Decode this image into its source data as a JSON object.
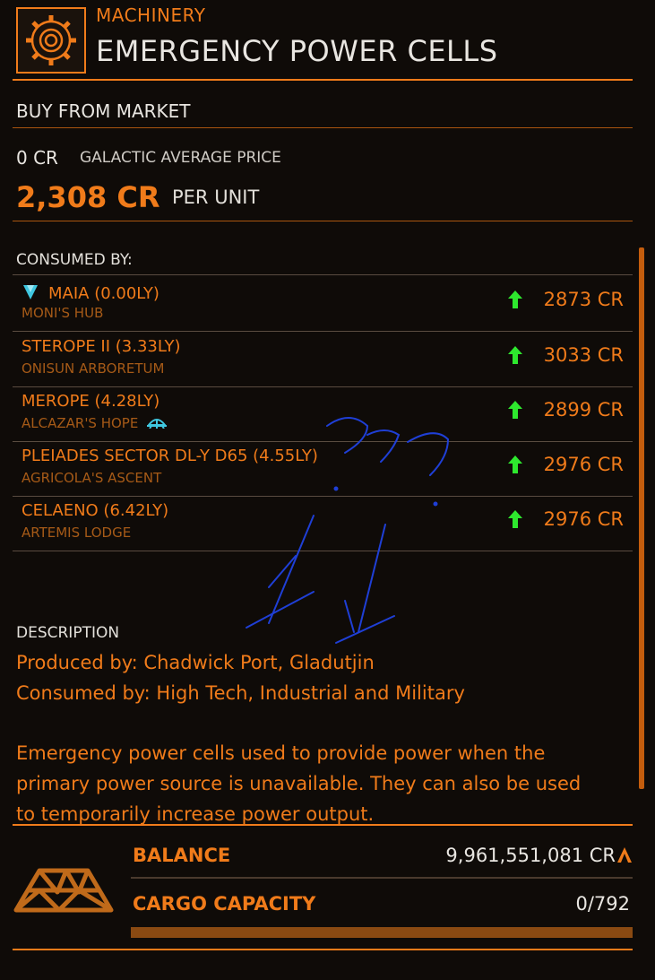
{
  "header": {
    "category": "MACHINERY",
    "title": "EMERGENCY POWER CELLS",
    "icon": "gear-icon"
  },
  "market": {
    "buy_label": "BUY FROM MARKET",
    "avg_price": "0 CR",
    "avg_label": "GALACTIC AVERAGE PRICE",
    "unit_price": "2,308 CR",
    "unit_label": "PER UNIT"
  },
  "consumed": {
    "label": "CONSUMED BY:",
    "rows": [
      {
        "name": "MAIA (0.00LY)",
        "station": "MONI'S HUB",
        "price": "2873 CR",
        "icon": "gem-icon"
      },
      {
        "name": "STEROPE II (3.33LY)",
        "station": "ONISUN ARBORETUM",
        "price": "3033 CR"
      },
      {
        "name": "MEROPE (4.28LY)",
        "station": "ALCAZAR'S HOPE",
        "price": "2899 CR",
        "icon": "outpost-icon"
      },
      {
        "name": "PLEIADES SECTOR DL-Y D65 (4.55LY)",
        "station": "AGRICOLA'S ASCENT",
        "price": "2976 CR"
      },
      {
        "name": "CELAENO (6.42LY)",
        "station": "ARTEMIS LODGE",
        "price": "2976 CR"
      }
    ]
  },
  "description": {
    "label": "DESCRIPTION",
    "lines": [
      "Produced by: Chadwick Port, Gladutjin",
      "Consumed by: High Tech, Industrial and Military",
      "Emergency power cells used to provide power when the",
      "primary power source is unavailable. They can also be used",
      "to temporarily increase power output."
    ]
  },
  "status": {
    "balance_label": "BALANCE",
    "balance_value": "9,961,551,081 CR",
    "cargo_label": "CARGO CAPACITY",
    "cargo_value": "0/792",
    "cargo_fraction": 0
  },
  "colors": {
    "accent": "#f07b1a",
    "up_arrow": "#2ee82e",
    "annotation": "#1f3fd6"
  }
}
